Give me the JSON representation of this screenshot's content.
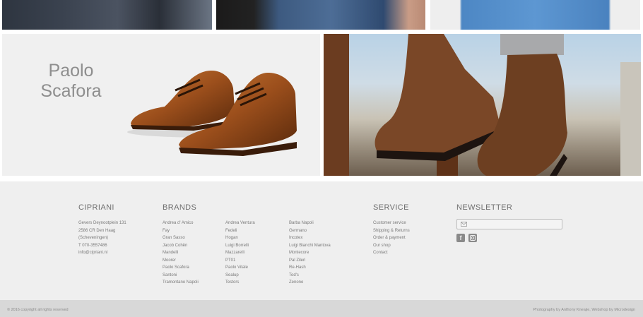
{
  "promo": {
    "title_line1": "Paolo",
    "title_line2": "Scafora"
  },
  "footer": {
    "cipriani": {
      "title": "CIPRIANI",
      "lines": [
        "Gevers Deynootplein 131",
        "2586 CR Den Haag",
        "(Scheveningen)",
        "T 070-3557486",
        "info@cipriani.nl"
      ]
    },
    "brands": {
      "title": "BRANDS",
      "col1": [
        "Andrea d' Amico",
        "Fay",
        "Gran Sasso",
        "Jacob Cohën",
        "Mandelli",
        "Moorer",
        "Paolo Scafora",
        "Santoni",
        "Tramontano Napoli"
      ],
      "col2": [
        "Andrea Ventura",
        "Fedeli",
        "Hogan",
        "Luigi Borrelli",
        "Mazzarelli",
        "PT01",
        "Paolo Vitale",
        "Sealup",
        "Testors"
      ],
      "col3": [
        "Barba Napoli",
        "Germano",
        "Incotex",
        "Luigi Bianchi Mantova",
        "Montecore",
        "Pal Zileri",
        "Re-Hash",
        "Tod's",
        "Zenone"
      ]
    },
    "service": {
      "title": "SERVICE",
      "items": [
        "Customer service",
        "Shipping & Returns",
        "Order & payment",
        "Our shop",
        "Contact"
      ]
    },
    "newsletter": {
      "title": "NEWSLETTER"
    },
    "copyright": "© 2016 copyright all rights reserved",
    "credits": "Photography by Anthony Kneajie, Webshop by Microdesign"
  }
}
